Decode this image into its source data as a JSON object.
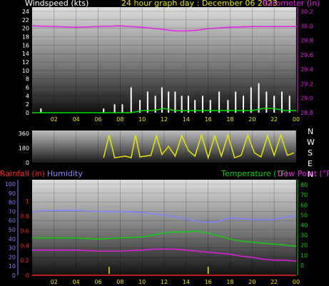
{
  "header": {
    "left_label": "Windspeed (kts)",
    "title": "24 hour graph day : December 06 2023",
    "right_label": "Barometer (in)"
  },
  "compass": [
    "N",
    "W",
    "S",
    "E",
    "N"
  ],
  "bottom_labels": {
    "rainfall": "Rainfall (in)",
    "humidity": "Humidity",
    "temperature": "Temperature (°F)",
    "dewpoint": "Dew Point (°F)"
  },
  "colors": {
    "wind": "#ffffff",
    "gust": "#00dd00",
    "barometer": "#e020e0",
    "direction": "#e8e800",
    "humidity": "#8080ff",
    "temperature": "#10d010",
    "dewpoint": "#e020e0",
    "rainfall": "#ff2020",
    "hour_ticks": "#e8e800"
  },
  "chart_data": [
    {
      "type": "line",
      "x_ticks": [
        "02",
        "04",
        "06",
        "08",
        "10",
        "12",
        "14",
        "16",
        "18",
        "20",
        "22",
        "00"
      ],
      "y_left": {
        "label": "Windspeed (kts)",
        "ticks": [
          0,
          2,
          4,
          6,
          8,
          10,
          12,
          14,
          16,
          18,
          20,
          22,
          24
        ],
        "lim": [
          0,
          24
        ]
      },
      "y_right": {
        "label": "Barometer (in)",
        "ticks": [
          28.8,
          29.0,
          29.2,
          29.4,
          29.6,
          29.8,
          30.0,
          30.2
        ],
        "lim": [
          28.8,
          30.2
        ]
      },
      "series": [
        {
          "name": "Barometer (in)",
          "axis": "right",
          "x": [
            0,
            2,
            4,
            6,
            8,
            10,
            12,
            13,
            14,
            15,
            16,
            18,
            20,
            22,
            24
          ],
          "y": [
            30.0,
            29.99,
            29.98,
            29.99,
            30.0,
            29.98,
            29.95,
            29.93,
            29.93,
            29.94,
            29.96,
            29.98,
            29.99,
            29.99,
            29.99
          ]
        },
        {
          "name": "Windspeed (kts)",
          "axis": "left",
          "style": "bars",
          "x": [
            0.8,
            6.5,
            7.5,
            8.2,
            9.0,
            9.8,
            10.5,
            11.2,
            11.8,
            12.4,
            13.0,
            13.6,
            14.2,
            14.8,
            15.5,
            16.2,
            17.0,
            17.8,
            18.5,
            19.2,
            19.9,
            20.6,
            21.3,
            22.0,
            22.7,
            23.4
          ],
          "y": [
            1,
            1,
            2,
            2,
            6,
            3,
            5,
            4,
            6,
            5,
            5,
            4,
            4,
            3,
            4,
            3,
            5,
            3,
            5,
            4,
            6,
            7,
            5,
            4,
            5,
            4
          ]
        },
        {
          "name": "Gust (kts)",
          "axis": "left",
          "x": [
            0,
            9,
            10,
            11,
            12,
            13,
            14,
            15,
            16,
            17,
            18,
            19,
            20,
            21,
            22,
            23,
            24
          ],
          "y": [
            0,
            0,
            0.5,
            0.5,
            1,
            0.5,
            0.5,
            0.5,
            0.5,
            0.5,
            0.5,
            0.5,
            0.5,
            1,
            1,
            0.5,
            0.5
          ]
        }
      ]
    },
    {
      "type": "line",
      "x_ticks": [
        "02",
        "04",
        "06",
        "08",
        "10",
        "12",
        "14",
        "16",
        "18",
        "20",
        "22",
        "00"
      ],
      "y_left": {
        "ticks": [
          0,
          180,
          360
        ],
        "lim": [
          0,
          360
        ]
      },
      "series": [
        {
          "name": "Wind Direction",
          "axis": "left",
          "x": [
            6.5,
            7.0,
            7.5,
            8.5,
            9.0,
            9.4,
            9.8,
            10.8,
            11.3,
            11.8,
            12.4,
            13.0,
            13.6,
            14.2,
            14.8,
            15.4,
            16.0,
            16.6,
            17.2,
            17.8,
            18.4,
            19.0,
            19.6,
            20.2,
            20.8,
            21.4,
            22.0,
            22.6,
            23.2,
            23.8
          ],
          "y": [
            60,
            340,
            60,
            80,
            60,
            340,
            70,
            90,
            330,
            100,
            200,
            80,
            330,
            150,
            80,
            340,
            60,
            330,
            80,
            340,
            60,
            90,
            340,
            120,
            70,
            330,
            90,
            340,
            90,
            120
          ]
        }
      ]
    },
    {
      "type": "line",
      "x_ticks": [
        "02",
        "04",
        "06",
        "08",
        "10",
        "12",
        "14",
        "16",
        "18",
        "20",
        "22",
        "00"
      ],
      "y_left_humidity": {
        "label": "Humidity",
        "ticks": [
          0,
          10,
          20,
          30,
          40,
          50,
          60,
          70,
          80,
          90,
          100
        ],
        "lim": [
          0,
          100
        ]
      },
      "y_left_rain": {
        "label": "Rainfall (in)",
        "ticks": [
          0,
          0.2,
          0.4,
          0.6,
          0.8,
          1
        ],
        "lim": [
          0,
          1
        ]
      },
      "y_right": {
        "label": "Temperature (°F)",
        "ticks": [
          0,
          10,
          20,
          30,
          40,
          50,
          60,
          70,
          80
        ],
        "lim": [
          -10,
          85
        ]
      },
      "series": [
        {
          "name": "Humidity",
          "axis": "humidity",
          "x": [
            0,
            2,
            4,
            6,
            8,
            10,
            12,
            14,
            15,
            16,
            17,
            18,
            19,
            20,
            22,
            23,
            24
          ],
          "y": [
            70,
            71,
            71,
            70,
            70,
            69,
            66,
            62,
            59,
            58,
            59,
            63,
            62,
            61,
            61,
            64,
            65
          ]
        },
        {
          "name": "Temperature (°F)",
          "axis": "right",
          "x": [
            0,
            2,
            4,
            6,
            8,
            10,
            11,
            12,
            13,
            14,
            15,
            16,
            17,
            18,
            19,
            20,
            21,
            22,
            23,
            24
          ],
          "y": [
            27,
            27,
            27,
            26,
            27,
            28,
            30,
            32,
            33,
            33,
            34,
            32,
            29,
            26,
            24,
            23,
            22,
            21,
            20,
            19
          ]
        },
        {
          "name": "Dew Point (°F)",
          "axis": "right",
          "x": [
            0,
            2,
            4,
            6,
            8,
            10,
            11,
            12,
            13,
            14,
            15,
            16,
            17,
            18,
            19,
            20,
            21,
            22,
            23,
            24
          ],
          "y": [
            15,
            15,
            15,
            14,
            14,
            15,
            16,
            16,
            16,
            15,
            14,
            13,
            12,
            11,
            9,
            8,
            6,
            5,
            5,
            4
          ]
        },
        {
          "name": "Rainfall (in)",
          "axis": "rain",
          "x": [
            0,
            24
          ],
          "y": [
            0,
            0
          ]
        }
      ]
    }
  ]
}
